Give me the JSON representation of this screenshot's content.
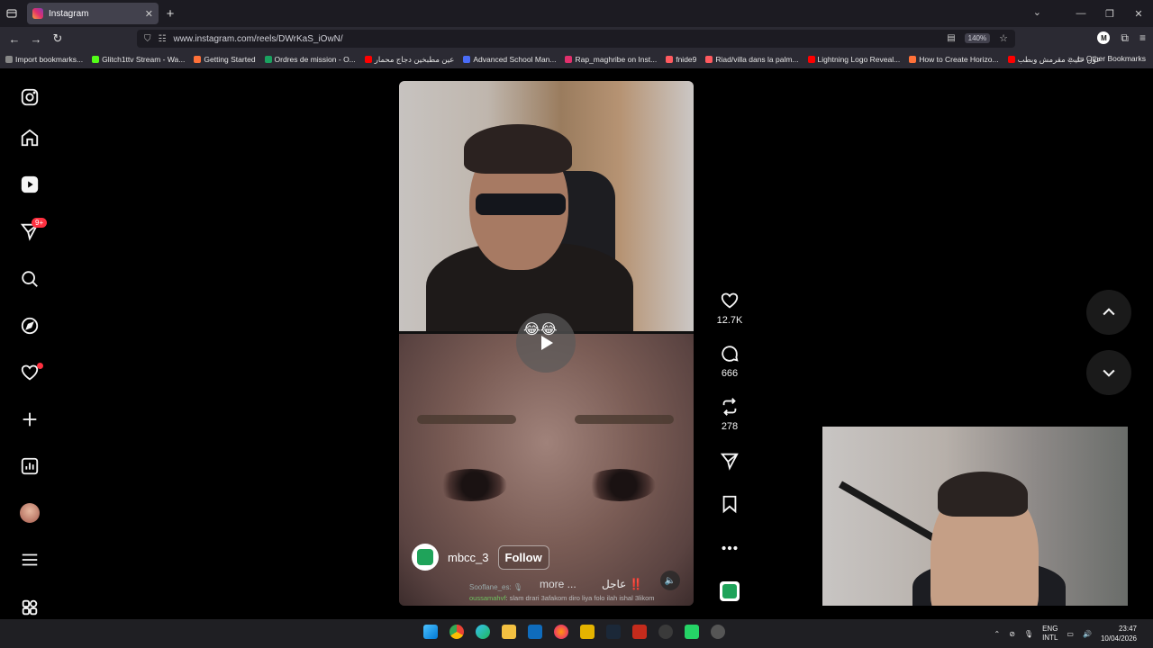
{
  "browser": {
    "tab_title": "Instagram",
    "url": "www.instagram.com/reels/DWrKaS_iOwN/",
    "zoom": "140%",
    "bookmarks": [
      {
        "label": "Import bookmarks...",
        "color": "#888888"
      },
      {
        "label": "Glitch1ttv Stream - Wa...",
        "color": "#53fc18"
      },
      {
        "label": "Getting Started",
        "color": "#ff7139"
      },
      {
        "label": "Ordres de mission - O...",
        "color": "#1aa260"
      },
      {
        "label": "عين مطبخين دجاج محمار",
        "color": "#ff0000"
      },
      {
        "label": "Advanced School Man...",
        "color": "#4a6cf7"
      },
      {
        "label": "Rap_maghribe on Inst...",
        "color": "#e1306c"
      },
      {
        "label": "fnide9",
        "color": "#ff5a5f"
      },
      {
        "label": "Riad/villa dans la palm...",
        "color": "#ff5a5f"
      },
      {
        "label": "Lightning Logo Reveal...",
        "color": "#ff0000"
      },
      {
        "label": "How to Create Horizo...",
        "color": "#ff7139"
      },
      {
        "label": "عون حليب مقرمش وبطب",
        "color": "#ff0000"
      }
    ],
    "other_bookmarks": "Other Bookmarks"
  },
  "sidebar": {
    "notifications_badge": "9+"
  },
  "reel": {
    "username": "mbcc_3",
    "follow_label": "Follow",
    "caption": "عاجل ‼️",
    "more_label": "more ...",
    "emoji": "😂😂",
    "chat_line_1": "Sooflane_es: 🎙",
    "chat_user_2": "oussamahvf",
    "chat_text_2": ": slam drari 3afakom diro liya folo ilah ishal 3likom"
  },
  "actions": {
    "likes": "12.7K",
    "comments": "666",
    "reposts": "278"
  },
  "taskbar": {
    "lang_1": "ENG",
    "lang_2": "INTL",
    "time": "23:47",
    "date": "10/04/2026"
  }
}
